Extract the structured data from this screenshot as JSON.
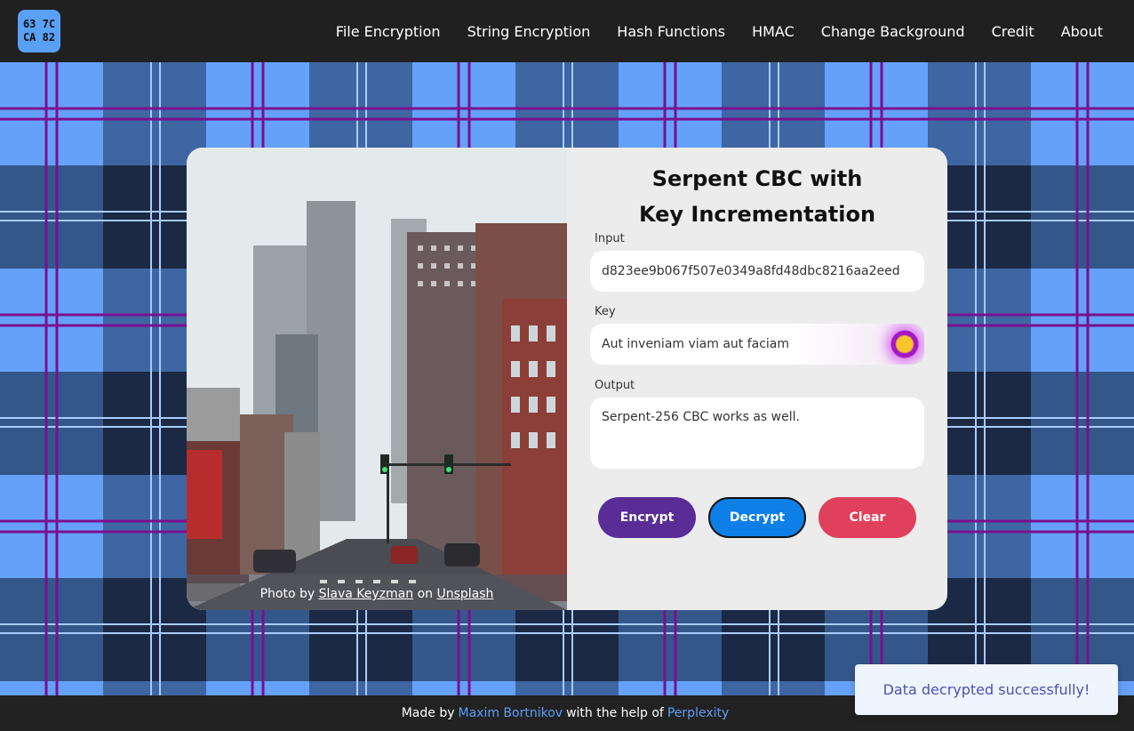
{
  "logo": {
    "line1": "63 7C",
    "line2": "CA 82"
  },
  "nav": {
    "items": [
      {
        "label": "File Encryption"
      },
      {
        "label": "String Encryption"
      },
      {
        "label": "Hash Functions"
      },
      {
        "label": "HMAC"
      },
      {
        "label": "Change Background"
      },
      {
        "label": "Credit"
      },
      {
        "label": "About"
      }
    ]
  },
  "card": {
    "title_line1": "Serpent CBC with",
    "title_line2": "Key Incrementation",
    "photo_credit": {
      "prefix": "Photo by",
      "author": "Slava Keyzman",
      "middle": "on",
      "site": "Unsplash"
    },
    "input": {
      "label": "Input",
      "value": "d823ee9b067f507e0349a8fd48dbc8216aa2eed"
    },
    "key": {
      "label": "Key",
      "value": "Aut inveniam viam aut faciam"
    },
    "output": {
      "label": "Output",
      "value": "Serpent-256 CBC works as well."
    },
    "buttons": {
      "encrypt": "Encrypt",
      "decrypt": "Decrypt",
      "clear": "Clear"
    }
  },
  "footer": {
    "prefix": "Made by",
    "author": "Maxim Bortnikov",
    "middle": "with the help of",
    "helper": "Perplexity"
  },
  "toast": {
    "message": "Data decrypted successfully!"
  },
  "colors": {
    "nav_bg": "#202020",
    "accent_blue": "#5aa0f6",
    "plaid_light": "#65a1f9",
    "plaid_mid": "#315384",
    "plaid_dark": "#1b2944",
    "plaid_stripe": "#7a0f8f",
    "encrypt_btn": "#5a2d96",
    "decrypt_btn": "#0d7fe6",
    "clear_btn": "#e0405c",
    "toast_text": "#4b52b0"
  }
}
